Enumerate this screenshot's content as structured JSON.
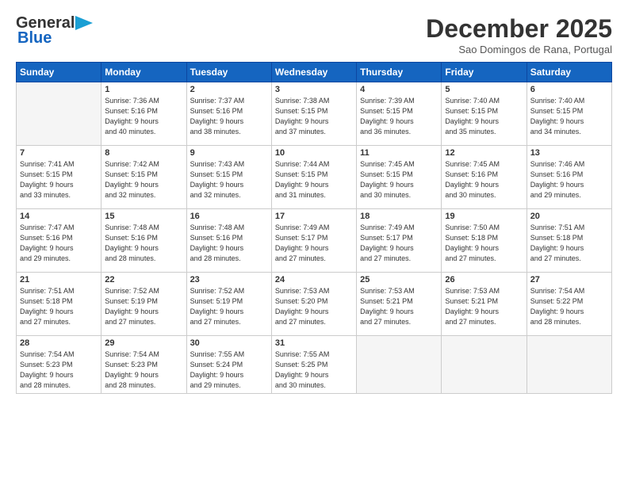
{
  "header": {
    "logo_line1": "General",
    "logo_line2": "Blue",
    "month": "December 2025",
    "location": "Sao Domingos de Rana, Portugal"
  },
  "weekdays": [
    "Sunday",
    "Monday",
    "Tuesday",
    "Wednesday",
    "Thursday",
    "Friday",
    "Saturday"
  ],
  "weeks": [
    [
      {
        "day": "",
        "info": ""
      },
      {
        "day": "1",
        "info": "Sunrise: 7:36 AM\nSunset: 5:16 PM\nDaylight: 9 hours\nand 40 minutes."
      },
      {
        "day": "2",
        "info": "Sunrise: 7:37 AM\nSunset: 5:16 PM\nDaylight: 9 hours\nand 38 minutes."
      },
      {
        "day": "3",
        "info": "Sunrise: 7:38 AM\nSunset: 5:15 PM\nDaylight: 9 hours\nand 37 minutes."
      },
      {
        "day": "4",
        "info": "Sunrise: 7:39 AM\nSunset: 5:15 PM\nDaylight: 9 hours\nand 36 minutes."
      },
      {
        "day": "5",
        "info": "Sunrise: 7:40 AM\nSunset: 5:15 PM\nDaylight: 9 hours\nand 35 minutes."
      },
      {
        "day": "6",
        "info": "Sunrise: 7:40 AM\nSunset: 5:15 PM\nDaylight: 9 hours\nand 34 minutes."
      }
    ],
    [
      {
        "day": "7",
        "info": "Sunrise: 7:41 AM\nSunset: 5:15 PM\nDaylight: 9 hours\nand 33 minutes."
      },
      {
        "day": "8",
        "info": "Sunrise: 7:42 AM\nSunset: 5:15 PM\nDaylight: 9 hours\nand 32 minutes."
      },
      {
        "day": "9",
        "info": "Sunrise: 7:43 AM\nSunset: 5:15 PM\nDaylight: 9 hours\nand 32 minutes."
      },
      {
        "day": "10",
        "info": "Sunrise: 7:44 AM\nSunset: 5:15 PM\nDaylight: 9 hours\nand 31 minutes."
      },
      {
        "day": "11",
        "info": "Sunrise: 7:45 AM\nSunset: 5:15 PM\nDaylight: 9 hours\nand 30 minutes."
      },
      {
        "day": "12",
        "info": "Sunrise: 7:45 AM\nSunset: 5:16 PM\nDaylight: 9 hours\nand 30 minutes."
      },
      {
        "day": "13",
        "info": "Sunrise: 7:46 AM\nSunset: 5:16 PM\nDaylight: 9 hours\nand 29 minutes."
      }
    ],
    [
      {
        "day": "14",
        "info": "Sunrise: 7:47 AM\nSunset: 5:16 PM\nDaylight: 9 hours\nand 29 minutes."
      },
      {
        "day": "15",
        "info": "Sunrise: 7:48 AM\nSunset: 5:16 PM\nDaylight: 9 hours\nand 28 minutes."
      },
      {
        "day": "16",
        "info": "Sunrise: 7:48 AM\nSunset: 5:16 PM\nDaylight: 9 hours\nand 28 minutes."
      },
      {
        "day": "17",
        "info": "Sunrise: 7:49 AM\nSunset: 5:17 PM\nDaylight: 9 hours\nand 27 minutes."
      },
      {
        "day": "18",
        "info": "Sunrise: 7:49 AM\nSunset: 5:17 PM\nDaylight: 9 hours\nand 27 minutes."
      },
      {
        "day": "19",
        "info": "Sunrise: 7:50 AM\nSunset: 5:18 PM\nDaylight: 9 hours\nand 27 minutes."
      },
      {
        "day": "20",
        "info": "Sunrise: 7:51 AM\nSunset: 5:18 PM\nDaylight: 9 hours\nand 27 minutes."
      }
    ],
    [
      {
        "day": "21",
        "info": "Sunrise: 7:51 AM\nSunset: 5:18 PM\nDaylight: 9 hours\nand 27 minutes."
      },
      {
        "day": "22",
        "info": "Sunrise: 7:52 AM\nSunset: 5:19 PM\nDaylight: 9 hours\nand 27 minutes."
      },
      {
        "day": "23",
        "info": "Sunrise: 7:52 AM\nSunset: 5:19 PM\nDaylight: 9 hours\nand 27 minutes."
      },
      {
        "day": "24",
        "info": "Sunrise: 7:53 AM\nSunset: 5:20 PM\nDaylight: 9 hours\nand 27 minutes."
      },
      {
        "day": "25",
        "info": "Sunrise: 7:53 AM\nSunset: 5:21 PM\nDaylight: 9 hours\nand 27 minutes."
      },
      {
        "day": "26",
        "info": "Sunrise: 7:53 AM\nSunset: 5:21 PM\nDaylight: 9 hours\nand 27 minutes."
      },
      {
        "day": "27",
        "info": "Sunrise: 7:54 AM\nSunset: 5:22 PM\nDaylight: 9 hours\nand 28 minutes."
      }
    ],
    [
      {
        "day": "28",
        "info": "Sunrise: 7:54 AM\nSunset: 5:23 PM\nDaylight: 9 hours\nand 28 minutes."
      },
      {
        "day": "29",
        "info": "Sunrise: 7:54 AM\nSunset: 5:23 PM\nDaylight: 9 hours\nand 28 minutes."
      },
      {
        "day": "30",
        "info": "Sunrise: 7:55 AM\nSunset: 5:24 PM\nDaylight: 9 hours\nand 29 minutes."
      },
      {
        "day": "31",
        "info": "Sunrise: 7:55 AM\nSunset: 5:25 PM\nDaylight: 9 hours\nand 30 minutes."
      },
      {
        "day": "",
        "info": ""
      },
      {
        "day": "",
        "info": ""
      },
      {
        "day": "",
        "info": ""
      }
    ]
  ]
}
